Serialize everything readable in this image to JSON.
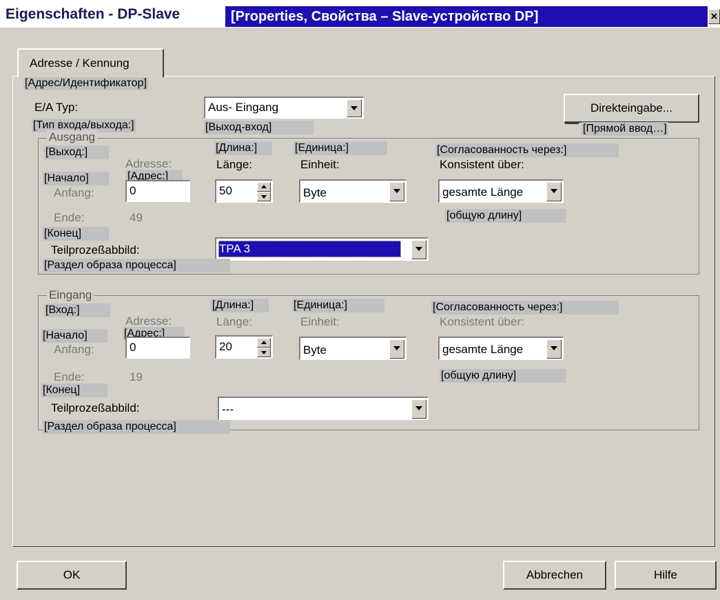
{
  "window": {
    "title": "Eigenschaften - DP-Slave",
    "title_annotation": "[Properties, Свойства – Slave-устройство DP]",
    "close": "×"
  },
  "tab": {
    "label": "Adresse / Kennung",
    "annotation": "[Адрес/Идентификатор]"
  },
  "io_type": {
    "label": "E/A Typ:",
    "annotation": "[Тип входа/выхода:]",
    "value": "Aus- Eingang",
    "value_annotation": "[Выход-вход]"
  },
  "direct_input": {
    "label": "Direkteingabe...",
    "annotation": "[Прямой ввод…]"
  },
  "output": {
    "group_title": "Ausgang",
    "group_annotation": "[Выход:]",
    "address_label": "Adresse:",
    "address_annotation": "[Адрес:]",
    "start_label": "Anfang:",
    "start_annotation": "[Начало]",
    "start_value": "0",
    "length_label": "Länge:",
    "length_annotation": "[Длина:]",
    "length_value": "50",
    "unit_label": "Einheit:",
    "unit_annotation": "[Единица:]",
    "unit_value": "Byte",
    "consistent_label": "Konsistent über:",
    "consistent_annotation": "[Согласованность через:]",
    "consistent_value": "gesamte Länge",
    "consistent_value_annotation": "[общую длину]",
    "end_label": "Ende:",
    "end_value": "49",
    "end_annotation": "[Конец]",
    "tpa_label": "Teilprozeßabbild:",
    "tpa_value": "TPA 3",
    "tpa_annotation": "[Раздел образа процесса]"
  },
  "input": {
    "group_title": "Eingang",
    "group_annotation": "[Вход:]",
    "address_label": "Adresse:",
    "address_annotation": "[Адрес:]",
    "start_label": "Anfang:",
    "start_annotation": "[Начало]",
    "start_value": "0",
    "length_label": "Länge:",
    "length_annotation": "[Длина:]",
    "length_value": "20",
    "unit_label": "Einheit:",
    "unit_annotation": "[Единица:]",
    "unit_value": "Byte",
    "consistent_label": "Konsistent über:",
    "consistent_annotation": "[Согласованность через:]",
    "consistent_value": "gesamte Länge",
    "consistent_value_annotation": "[общую длину]",
    "end_label": "Ende:",
    "end_value": "19",
    "end_annotation": "[Конец]",
    "tpa_label": "Teilprozeßabbild:",
    "tpa_value": "---",
    "tpa_annotation": "[Раздел образа процесса]"
  },
  "buttons": {
    "ok": "OK",
    "cancel": "Abbrechen",
    "help": "Hilfe"
  }
}
